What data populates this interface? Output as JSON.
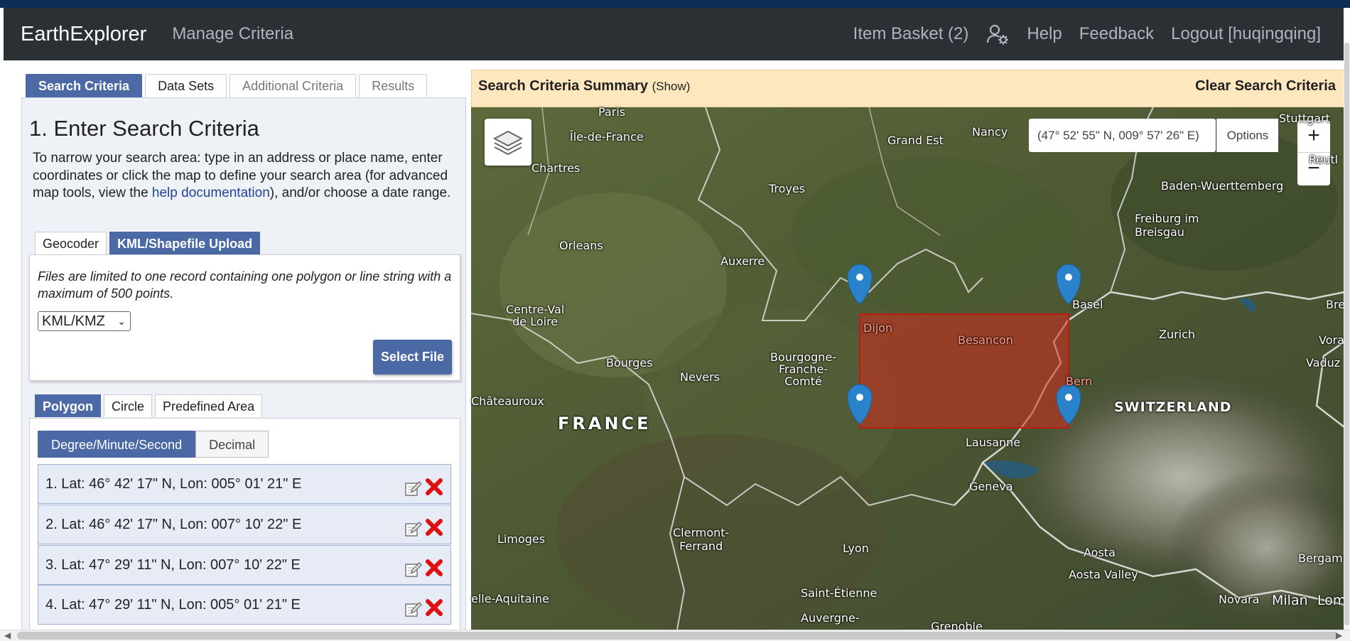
{
  "nav": {
    "brand": "EarthExplorer",
    "manage": "Manage Criteria",
    "basket": "Item Basket (2)",
    "user_icon": "user-gear-icon",
    "help": "Help",
    "feedback": "Feedback",
    "logout": "Logout [huqingqing]"
  },
  "tabs": [
    "Search Criteria",
    "Data Sets",
    "Additional Criteria",
    "Results"
  ],
  "section_title": "1. Enter Search Criteria",
  "intro": {
    "before": "To narrow your search area: type in an address or place name, enter coordinates or click the map to define your search area (for advanced map tools, view the ",
    "link": "help documentation",
    "after": "), and/or choose a date range."
  },
  "subtabs": [
    "Geocoder",
    "KML/Shapefile Upload"
  ],
  "upload": {
    "note": "Files are limited to one record containing one polygon or line string with a maximum of 500 points.",
    "format": "KML/KMZ",
    "select_file": "Select File"
  },
  "shape_tabs": [
    "Polygon",
    "Circle",
    "Predefined Area"
  ],
  "format_tabs": [
    "Degree/Minute/Second",
    "Decimal"
  ],
  "coordinates": [
    "1.  Lat: 46° 42' 17\" N, Lon: 005° 01' 21\" E",
    "2.  Lat: 46° 42' 17\" N, Lon: 007° 10' 22\" E",
    "3.  Lat: 47° 29' 11\" N, Lon: 007° 10' 22\" E",
    "4.  Lat: 47° 29' 11\" N, Lon: 005° 01' 21\" E"
  ],
  "summary": {
    "title": "Search Criteria Summary",
    "show": "(Show)",
    "clear": "Clear Search Criteria"
  },
  "map": {
    "coord_readout": "(47° 52' 55\" N, 009° 57' 26\" E)",
    "options": "Options",
    "zoom_in": "+",
    "zoom_out": "−",
    "selection_color": "#d42a1e",
    "places": {
      "paris": "Paris",
      "idf": "Île-de-France",
      "chartres": "Chartres",
      "grandest": "Grand Est",
      "nancy": "Nancy",
      "stuttgart": "Stuttgart",
      "reutlingen": "Reutl",
      "bw": "Baden-Wuerttemberg",
      "troyes": "Troyes",
      "freiburg": "Freiburg im\nBreisgau",
      "orleans": "Orleans",
      "auxerre": "Auxerre",
      "cvl": "Centre-Val\nde Loire",
      "dijon": "Dijon",
      "besancon": "Besancon",
      "basel": "Basel",
      "zurich": "Zurich",
      "bregenz": "Breg",
      "vorarlberg": "Vorarlb",
      "vaduz": "Vaduz",
      "bourges": "Bourges",
      "nevers": "Nevers",
      "bfc": "Bourgogne-\nFranche-\nComté",
      "bern": "Bern",
      "chateauroux": "Châteauroux",
      "france": "FRANCE",
      "switzerland": "SWITZERLAND",
      "lausanne": "Lausanne",
      "geneva": "Geneva",
      "limoges": "Limoges",
      "clermont": "Clermont-\nFerrand",
      "lyon": "Lyon",
      "aosta": "Aosta",
      "aostavalley": "Aosta Valley",
      "bergamo": "Bergam",
      "naquitaine": "elle-Aquitaine",
      "stetienne": "Saint-Étienne",
      "novara": "Novara",
      "milan": "Milan",
      "lom": "Lom",
      "ara": "Auvergne-",
      "grenoble": "Grenoble"
    }
  }
}
